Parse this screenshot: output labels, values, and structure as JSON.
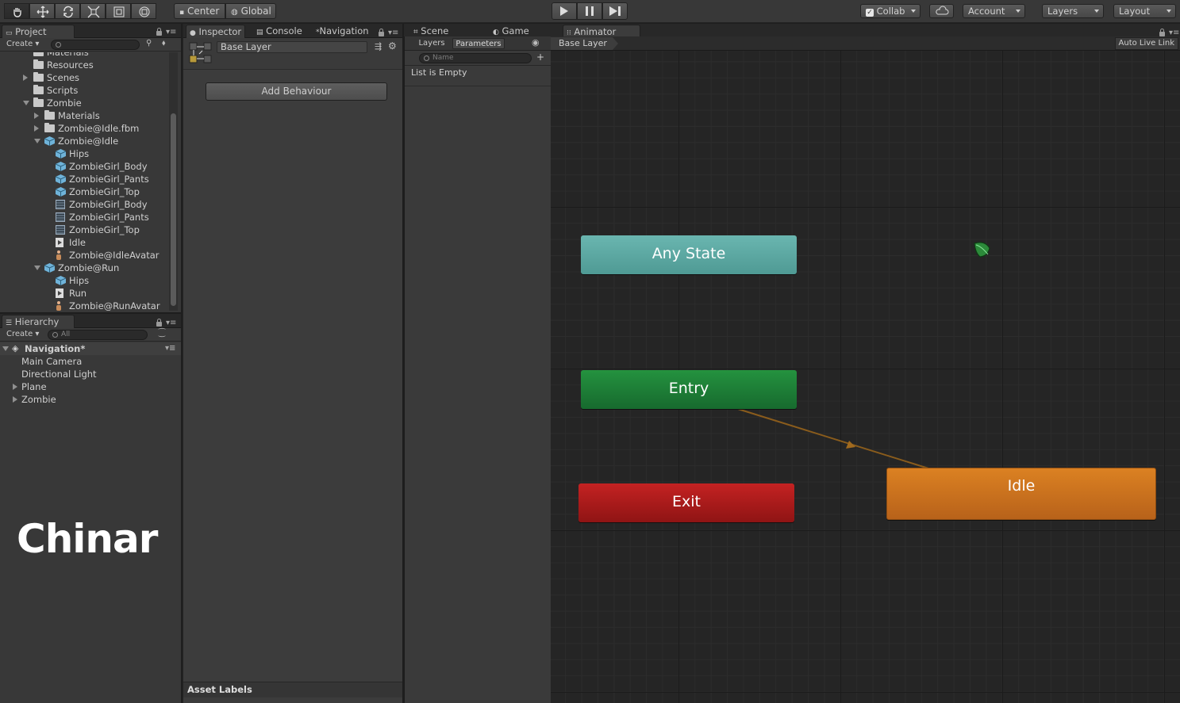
{
  "toolbar": {
    "pivot_center": "Center",
    "pivot_global": "Global",
    "collab": "Collab",
    "account": "Account",
    "layers": "Layers",
    "layout": "Layout",
    "tools": [
      "hand-icon",
      "move-icon",
      "rotate-icon",
      "scale-icon",
      "rect-icon",
      "transform-icon"
    ]
  },
  "project": {
    "tab": "Project",
    "create": "Create",
    "items": [
      {
        "label": "Materials",
        "kind": "folder"
      },
      {
        "label": "Resources",
        "kind": "folder"
      },
      {
        "label": "Scenes",
        "kind": "folder"
      },
      {
        "label": "Scripts",
        "kind": "folder"
      },
      {
        "label": "Zombie",
        "kind": "folder"
      },
      {
        "label": "Materials",
        "kind": "folder"
      },
      {
        "label": "Zombie@Idle.fbm",
        "kind": "folder"
      },
      {
        "label": "Zombie@Idle",
        "kind": "model"
      },
      {
        "label": "Hips",
        "kind": "model"
      },
      {
        "label": "ZombieGirl_Body",
        "kind": "model"
      },
      {
        "label": "ZombieGirl_Pants",
        "kind": "model"
      },
      {
        "label": "ZombieGirl_Top",
        "kind": "model"
      },
      {
        "label": "ZombieGirl_Body",
        "kind": "mesh"
      },
      {
        "label": "ZombieGirl_Pants",
        "kind": "mesh"
      },
      {
        "label": "ZombieGirl_Top",
        "kind": "mesh"
      },
      {
        "label": "Idle",
        "kind": "anim"
      },
      {
        "label": "Zombie@IdleAvatar",
        "kind": "avatar"
      },
      {
        "label": "Zombie@Run",
        "kind": "model"
      },
      {
        "label": "Hips",
        "kind": "model"
      },
      {
        "label": "Run",
        "kind": "anim"
      },
      {
        "label": "Zombie@RunAvatar",
        "kind": "avatar"
      }
    ]
  },
  "hierarchy": {
    "tab": "Hierarchy",
    "create": "Create",
    "search_placeholder": "All",
    "scene": "Navigation*",
    "items": [
      "Main Camera",
      "Directional Light",
      "Plane",
      "Zombie"
    ]
  },
  "watermark": "Chinar",
  "inspector": {
    "tabs": [
      "Inspector",
      "Console",
      "Navigation"
    ],
    "layer_name": "Base Layer",
    "add_behaviour": "Add Behaviour",
    "asset_labels": "Asset Labels"
  },
  "scene_tabs": [
    "Scene",
    "Game",
    "Animator"
  ],
  "animator": {
    "left_tabs": [
      "Layers",
      "Parameters"
    ],
    "search_placeholder": "Name",
    "empty_text": "List is Empty",
    "breadcrumb": "Base Layer",
    "auto_live_link": "Auto Live Link",
    "states": {
      "any_state": "Any State",
      "entry": "Entry",
      "exit": "Exit",
      "idle": "Idle"
    },
    "colors": {
      "any_state": "#5aa7a1",
      "entry": "#1c7e36",
      "exit": "#a91919",
      "idle": "#d0751d",
      "transition": "#8a5c1c"
    }
  }
}
